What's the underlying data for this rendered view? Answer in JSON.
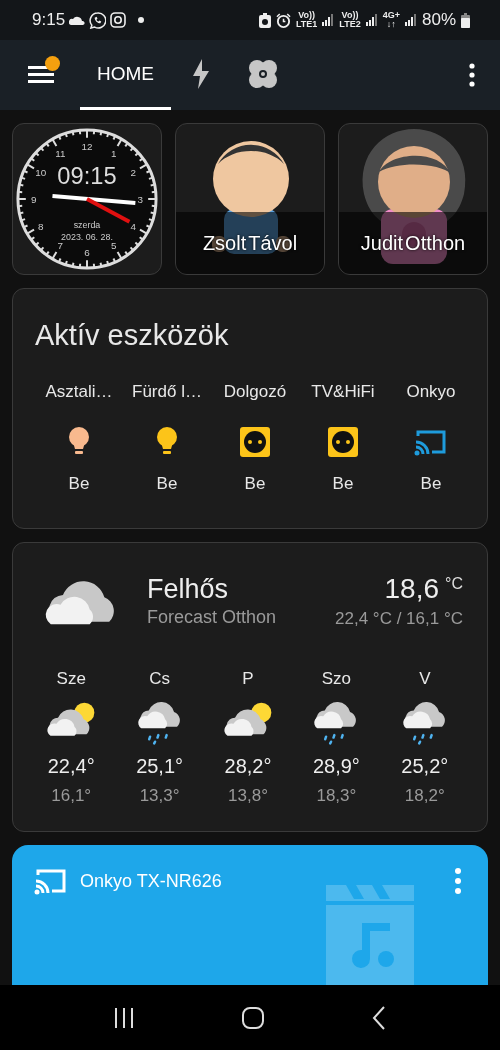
{
  "status_bar": {
    "time": "9:15",
    "network": [
      {
        "top": "Vo))",
        "bottom": "LTE1"
      },
      {
        "top": "Vo))",
        "bottom": "LTE2"
      },
      {
        "top": "4G+",
        "bottom": "↓↑"
      }
    ],
    "battery": "80%"
  },
  "tabs": [
    {
      "kind": "text",
      "label": "HOME",
      "selected": true
    },
    {
      "kind": "bolt",
      "selected": false
    },
    {
      "kind": "fan",
      "selected": false
    }
  ],
  "clock": {
    "time": "09:15",
    "weekday": "szerda",
    "date": "2023. 06. 28.",
    "numerals": [
      "12",
      "1",
      "2",
      "3",
      "4",
      "5",
      "6",
      "7",
      "8",
      "9",
      "10",
      "11"
    ]
  },
  "people": [
    {
      "name": "Zsolt",
      "state": "Távol",
      "kind": "short_hair"
    },
    {
      "name": "Judit",
      "state": "Otthon",
      "kind": "long_hair"
    }
  ],
  "devices": {
    "title": "Aktív eszközök",
    "items": [
      {
        "name": "Asztali…",
        "kind": "bulb",
        "color": "#f8b98e",
        "state": "Be"
      },
      {
        "name": "Fürdő l…",
        "kind": "bulb",
        "color": "#fcc419",
        "state": "Be"
      },
      {
        "name": "Dolgozó",
        "kind": "socket",
        "color": "#fcc419",
        "state": "Be"
      },
      {
        "name": "TV&HiFi",
        "kind": "socket",
        "color": "#fcc419",
        "state": "Be"
      },
      {
        "name": "Onkyo",
        "kind": "cast",
        "color": "#1e9bdc",
        "state": "Be"
      }
    ]
  },
  "weather": {
    "condition": "Felhős",
    "kind": "cloudy",
    "source": "Forecast Otthon",
    "temperature": "18,6",
    "unit": "°C",
    "range": "22,4 °C / 16,1 °C",
    "forecast": [
      {
        "day": "Sze",
        "kind": "partly_cloudy",
        "high": "22,4°",
        "low": "16,1°"
      },
      {
        "day": "Cs",
        "kind": "rainy",
        "high": "25,1°",
        "low": "13,3°"
      },
      {
        "day": "P",
        "kind": "partly_cloudy",
        "high": "28,2°",
        "low": "13,8°"
      },
      {
        "day": "Szo",
        "kind": "rainy",
        "high": "28,9°",
        "low": "18,3°"
      },
      {
        "day": "V",
        "kind": "rainy",
        "high": "25,2°",
        "low": "18,2°"
      }
    ]
  },
  "media": {
    "title": "Onkyo TX-NR626"
  }
}
